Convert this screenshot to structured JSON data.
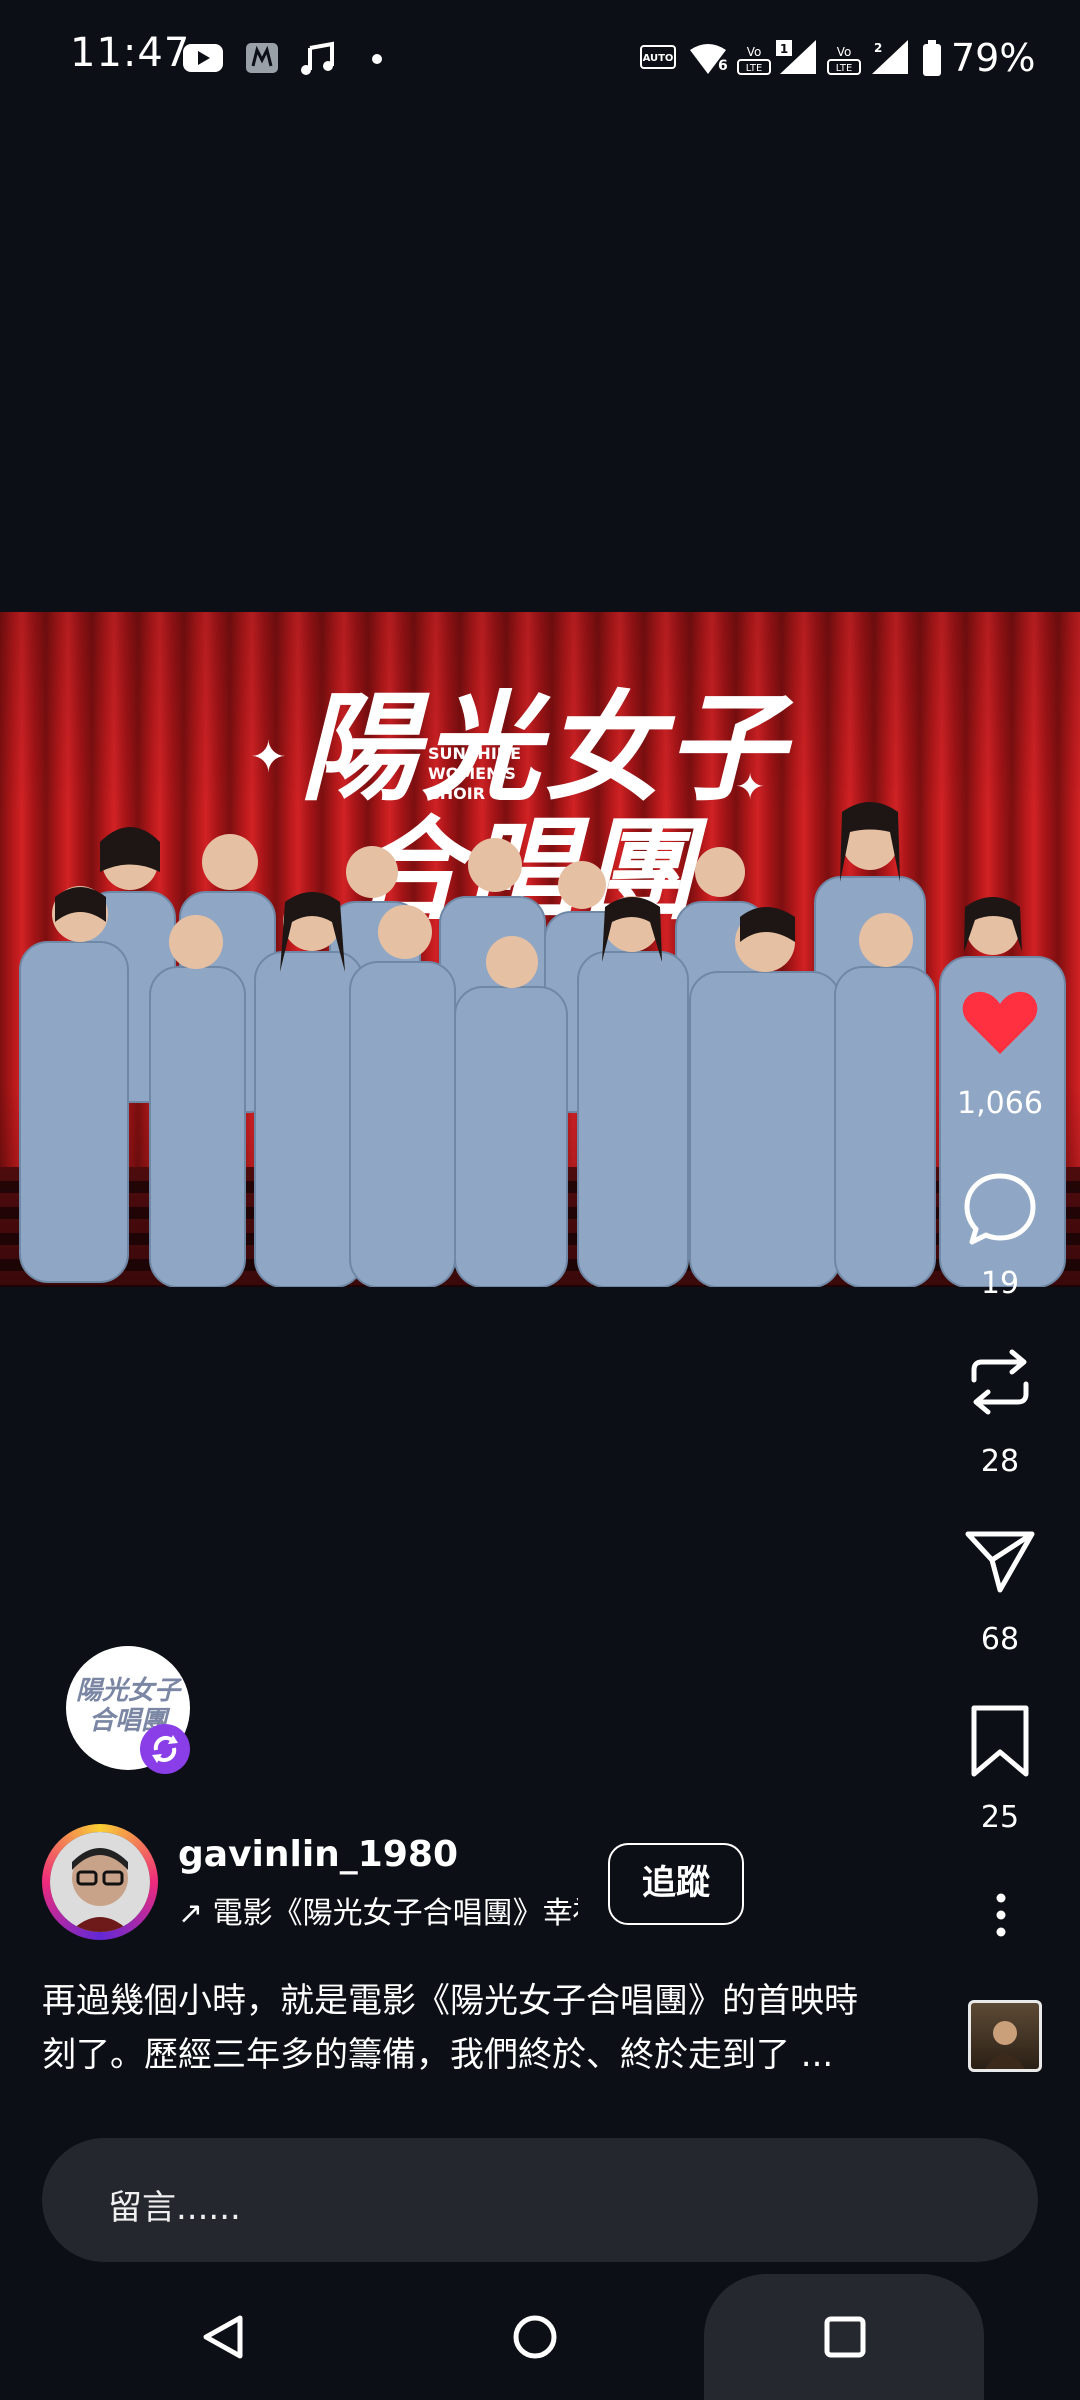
{
  "status_bar": {
    "time": "11:47",
    "battery_percent": "79%",
    "icons": [
      "youtube-icon",
      "app-icon",
      "music-note-icon",
      "dot-icon",
      "auto-hz-icon",
      "wifi-icon",
      "volte-icon",
      "signal-sim1-icon",
      "volte-icon",
      "signal-sim2-icon",
      "battery-icon"
    ]
  },
  "post": {
    "poster_title_line1": "陽光女子",
    "poster_title_line2": "合唱團",
    "poster_subtitle": "SUNSHINE\nWOMEN'S\nCHOIR",
    "username": "gavinlin_1980",
    "song_text": "↗ 電影《陽光女子合唱團》幸福",
    "follow_label": "追蹤",
    "caption_line1": "再過幾個小時，就是電影《陽光女子合唱團》的首映時",
    "caption_line2": "刻了。歷經三年多的籌備，我們終於、終於走到了 ...",
    "sound_disc_text": "陽光女子\n合唱團"
  },
  "actions": {
    "likes": "1,066",
    "comments": "19",
    "reposts": "28",
    "shares": "68",
    "saves": "25"
  },
  "comment_input": {
    "placeholder": "留言......"
  },
  "colors": {
    "background": "#0c0f15",
    "like_red": "#ff3040",
    "curtain_red": "#c01a1d",
    "uniform_blue": "#8fa7c4",
    "remix_purple": "#8a3ee8"
  }
}
